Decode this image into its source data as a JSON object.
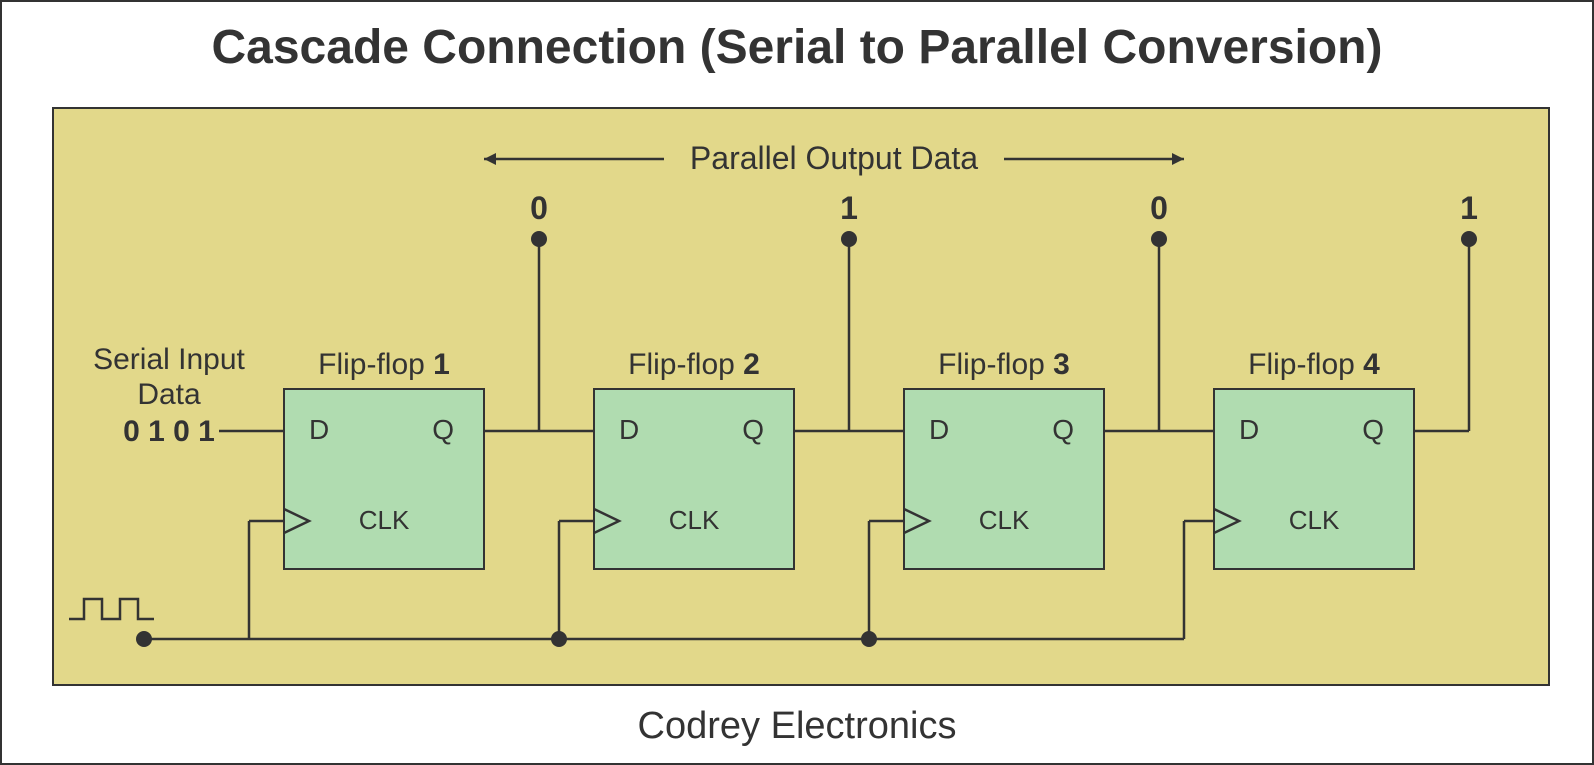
{
  "title": "Cascade Connection (Serial to Parallel Conversion)",
  "footer": "Codrey Electronics",
  "parallel_label": "Parallel Output Data",
  "serial_label_line1": "Serial Input",
  "serial_label_line2": "Data",
  "serial_value": "0 1 0 1",
  "outputs": [
    "0",
    "1",
    "0",
    "1"
  ],
  "flipflops": [
    {
      "label_prefix": "Flip-flop ",
      "num": "1",
      "d": "D",
      "q": "Q",
      "clk": "CLK"
    },
    {
      "label_prefix": "Flip-flop ",
      "num": "2",
      "d": "D",
      "q": "Q",
      "clk": "CLK"
    },
    {
      "label_prefix": "Flip-flop ",
      "num": "3",
      "d": "D",
      "q": "Q",
      "clk": "CLK"
    },
    {
      "label_prefix": "Flip-flop ",
      "num": "4",
      "d": "D",
      "q": "Q",
      "clk": "CLK"
    }
  ]
}
